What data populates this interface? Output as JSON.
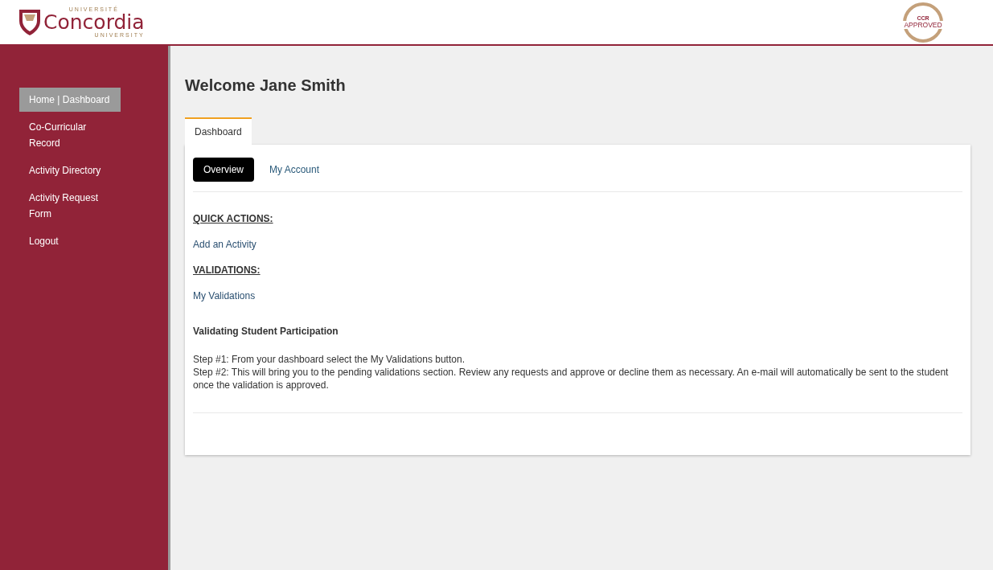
{
  "header": {
    "logo": {
      "top_text": "UNIVERSITÉ",
      "name": "Concordia",
      "bottom_text": "UNIVERSITY"
    },
    "badge": {
      "top_text": "CCR",
      "main_text": "APPROVED"
    }
  },
  "sidebar": {
    "items": [
      {
        "label": "Home | Dashboard",
        "selected": true
      },
      {
        "label": "Co-Curricular Record",
        "selected": false
      },
      {
        "label": "Activity Directory",
        "selected": false
      },
      {
        "label": "Activity Request Form",
        "selected": false
      },
      {
        "label": "Logout",
        "selected": false
      }
    ]
  },
  "page_title": "Welcome Jane Smith",
  "tabs": [
    {
      "label": "Dashboard",
      "selected": true
    }
  ],
  "subtabs": [
    {
      "label": "Overview",
      "selected": true
    },
    {
      "label": "My Account",
      "selected": false
    }
  ],
  "sections": [
    {
      "heading": "QUICK ACTIONS:",
      "links": [
        "Add an Activity"
      ]
    },
    {
      "heading": "VALIDATIONS:",
      "links": [
        "My Validations"
      ]
    }
  ],
  "help": {
    "title": "Validating Student Participation",
    "steps": [
      "Step #1: From your dashboard select the My Validations button.",
      "Step #2: This will bring you to the pending validations section. Review any requests and approve or decline them as necessary. An e-mail will automatically be sent to the student once the validation is approved."
    ]
  }
}
